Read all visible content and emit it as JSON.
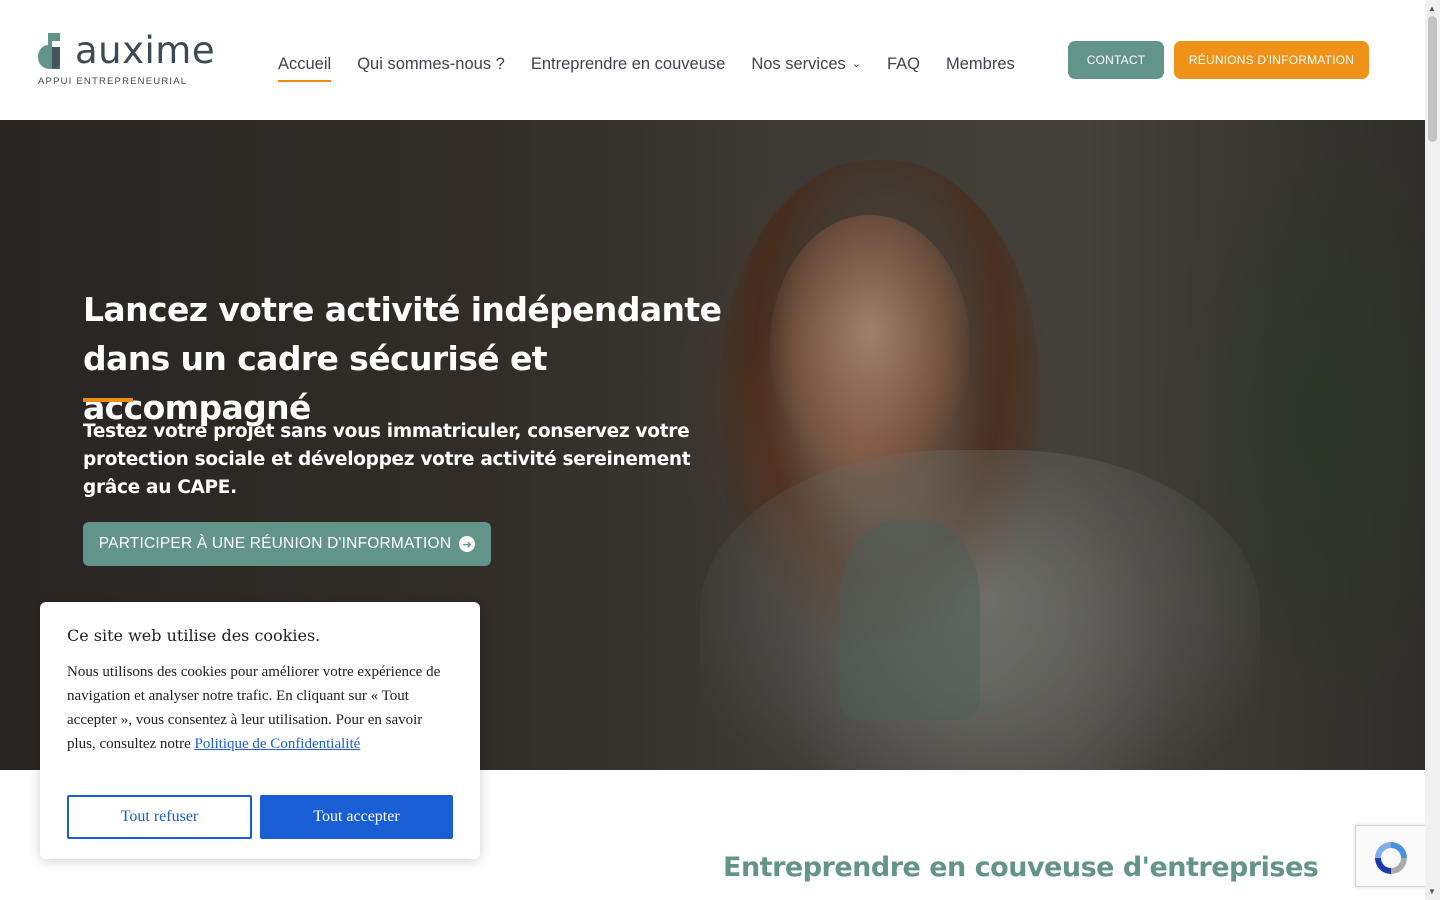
{
  "brand": {
    "name": "auxime",
    "tagline": "APPUI ENTREPRENEURIAL",
    "colors": {
      "primary": "#63948a",
      "accent": "#f09217",
      "text": "#3d4450"
    }
  },
  "nav": {
    "items": [
      {
        "label": "Accueil",
        "active": true
      },
      {
        "label": "Qui sommes-nous ?"
      },
      {
        "label": "Entreprendre en couveuse"
      },
      {
        "label": "Nos services",
        "has_dropdown": true
      },
      {
        "label": "FAQ"
      },
      {
        "label": "Membres"
      }
    ],
    "contact_label": "CONTACT",
    "reunions_label": "RÉUNIONS D'INFORMATION"
  },
  "hero": {
    "title": "Lancez votre activité indépendante dans un cadre sécurisé et accompagné",
    "text": "Testez votre projet sans vous immatriculer, conservez votre protection sociale et développez votre activité sereinement grâce au CAPE.",
    "cta_label": "PARTICIPER À UNE RÉUNION D'INFORMATION",
    "cta_icon": "arrow-circle-right-icon"
  },
  "section": {
    "title": "Entreprendre en couveuse d'entreprises"
  },
  "cookie": {
    "title": "Ce site web utilise des cookies.",
    "body": "Nous utilisons des cookies pour améliorer votre expérience de navigation et analyser notre trafic. En cliquant sur « Tout accepter », vous consentez à leur utilisation. Pour en savoir plus, consultez notre",
    "link_label": "Politique de Confidentialité",
    "refuse_label": "Tout refuser",
    "accept_label": "Tout accepter",
    "button_color": "#1a5ed6"
  },
  "recaptcha": {
    "icon": "recaptcha-icon"
  }
}
